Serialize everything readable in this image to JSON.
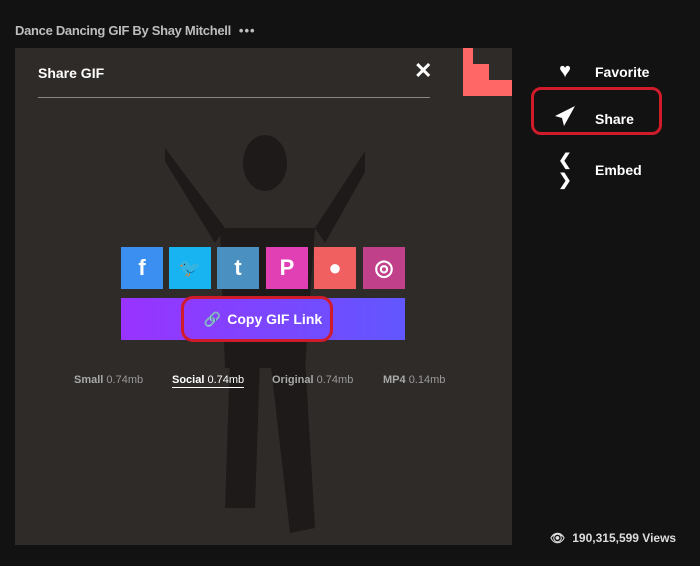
{
  "header": {
    "title": "Dance Dancing GIF By Shay Mitchell",
    "more": "•••"
  },
  "share_panel": {
    "title": "Share GIF",
    "close": "✕",
    "social": [
      {
        "name": "facebook",
        "glyph": "f",
        "color": "#3b8ff0"
      },
      {
        "name": "twitter",
        "glyph": "🐦",
        "color": "#18b4f2"
      },
      {
        "name": "tumblr",
        "glyph": "t",
        "color": "#4a90c0"
      },
      {
        "name": "pinterest",
        "glyph": "P",
        "color": "#e040b4"
      },
      {
        "name": "reddit",
        "glyph": "●",
        "color": "#f06060"
      },
      {
        "name": "instagram",
        "glyph": "◎",
        "color": "#c0408a"
      }
    ],
    "copy_label": "Copy GIF Link",
    "sizes": [
      {
        "label": "Small",
        "size": "0.74mb"
      },
      {
        "label": "Social",
        "size": "0.74mb"
      },
      {
        "label": "Original",
        "size": "0.74mb"
      },
      {
        "label": "MP4",
        "size": "0.14mb"
      }
    ]
  },
  "actions": {
    "favorite": "Favorite",
    "share": "Share",
    "embed": "Embed"
  },
  "views": "190,315,599 Views"
}
